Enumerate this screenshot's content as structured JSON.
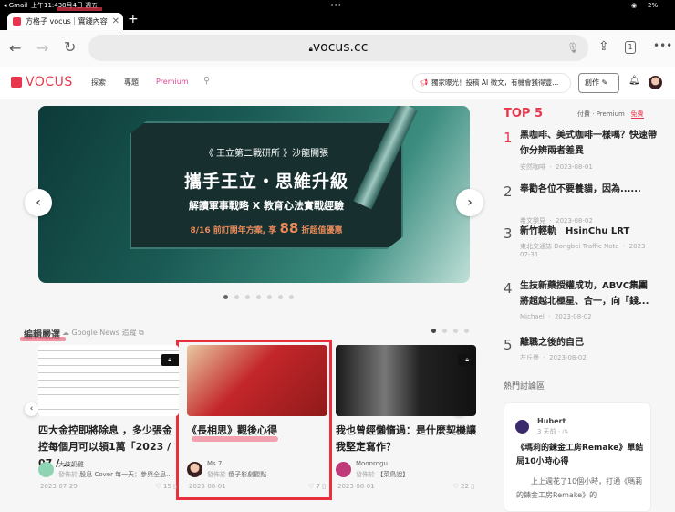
{
  "status_bar": {
    "back_app": "◂ Gmail",
    "time": "上午11:43",
    "date": "8月4日 週五",
    "battery": "2%"
  },
  "browser": {
    "tab_title": "方格子 vocus｜實踐內容",
    "url": "vocus.cc",
    "tab_count": "1"
  },
  "site_header": {
    "logo": "VOCUS",
    "nav": [
      "探索",
      "專題",
      "Premium"
    ],
    "announcement": "獨家曝光！投稿 AI 徵文，有機會獲得豐...",
    "create_button": "創作"
  },
  "banner": {
    "line1": "《 王立第二戰研所 》沙龍開張",
    "line2": "攜手王立・思維升級",
    "line3": "解讀軍事戰略 X 教育心法實戰經驗",
    "line4_pre": "8/16 前訂閱年方案, 享",
    "line4_num": "88",
    "line4_post": "折超值優惠",
    "slides": 7,
    "active_slide": 0
  },
  "editor_picks": {
    "title": "編輯嚴選",
    "google_news": "Google News 追蹤",
    "pages": 4,
    "active_page": 0,
    "cards": [
      {
        "title": "四大金控即將除息 ，多少張金控每個月可以領1萬「2023 / 07 / ...",
        "author": "大俠奶雞",
        "published_label": "發佈於",
        "publication": "股息 Cover 每一天：參與全息...",
        "date": "2023-07-29",
        "likes": "15",
        "locked": true
      },
      {
        "title": "《長相思》觀後心得",
        "author": "Ms.7",
        "published_label": "發佈於",
        "publication": "傻子影劇觀點",
        "date": "2023-08-01",
        "likes": "7",
        "locked": false
      },
      {
        "title": "我也曾經懶惰過：是什麼契機讓我堅定寫作？",
        "author": "Moonrogu",
        "published_label": "發佈於",
        "publication": "【菜鳥說】",
        "date": "2023-08-01",
        "likes": "22",
        "locked": true
      }
    ]
  },
  "top5": {
    "title": "TOP 5",
    "filters": [
      "付費",
      "Premium",
      "免費"
    ],
    "active_filter": "免費",
    "items": [
      {
        "rank": "1",
        "title": "黑咖啡、美式咖啡一樣嗎？快速帶你分辨兩者差異",
        "author": "安然咖啡",
        "date": "2023-08-01"
      },
      {
        "rank": "2",
        "title": "奉勸各位不要養貓，因為......",
        "author": "希文樂見",
        "date": "2023-08-02"
      },
      {
        "rank": "3",
        "title": "新竹輕軌　HsinChu LRT",
        "author": "東北交通誌 Dongbei Traffic Note",
        "date": "2023-07-31"
      },
      {
        "rank": "4",
        "title": "生技新藥授權成功，ABVC集團將超越北極星、合一，向「錢...",
        "author": "Michael",
        "date": "2023-08-02"
      },
      {
        "rank": "5",
        "title": "離職之後的自己",
        "author": "左丘曼",
        "date": "2023-08-02"
      }
    ]
  },
  "discussion": {
    "title": "熱門討論區",
    "author": "Hubert",
    "time": "3 天前",
    "post_title": "《瑪莉的鍊金工房Remake》單結局10小時心得",
    "excerpt": "上上週花了10個小時，打通《瑪莉的鍊金工房Remake》的"
  },
  "colors": {
    "brand": "#e8374c",
    "highlight": "#f06a7f"
  }
}
